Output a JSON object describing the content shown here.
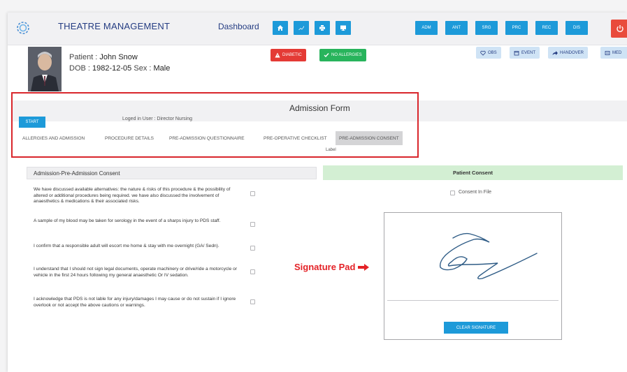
{
  "header": {
    "title": "THEATRE MANAGEMENT",
    "dashboard_label": "Dashboard",
    "icon_buttons": [
      "home-icon",
      "chart-icon",
      "print-icon",
      "monitor-icon"
    ],
    "module_buttons": [
      "ADM",
      "ANT",
      "SRG",
      "PRC",
      "REC",
      "DIS"
    ],
    "accent_color": "#1d9ad9",
    "power_color": "#e94b3c"
  },
  "patient": {
    "name_label": "Patient :",
    "name": "John Snow",
    "dob_label": "DOB :",
    "dob": "1982-12-05",
    "sex_label": "Sex :",
    "sex": "Male"
  },
  "badges": {
    "diabetic": "DIABETIC",
    "no_allergies": "NO ALLERGIES"
  },
  "actions": {
    "obs": "OBS",
    "event": "EVENT",
    "handover": "HANDOVER",
    "med": "MED"
  },
  "form": {
    "title": "Admission Form",
    "start_label": "START",
    "logged_in": "Loged in User : Director Nursing",
    "tabs": [
      "ALLERGIES AND ADMISSION",
      "PROCEDURE DETAILS",
      "PRE-ADMISSION QUESTIONNAIRE",
      "PRE-OPERATIVE CHECKLIST",
      "PRE-ADMISSION CONSENT"
    ],
    "active_tab": "PRE-ADMISSION CONSENT",
    "tab_caption": "Label"
  },
  "consent_section": {
    "heading": "Admission-Pre-Admission Consent",
    "items": [
      "We have discussed available alternatives: the nature & risks of this procedure & the possibility of altered or additional procedures being required. we have also discussed the involvement of anaesthetics & medications & their associated risks.",
      "A sample of my blood may be taken for serology in the event of a sharps injury to PDS staff.",
      "I confirm that a responsible adult will escort me home & stay with me overnight (GA/ Sedn).",
      "I understand that I should not sign legal documents, operate machinery or drive/ride a motorcycle or vehicle in the first 24 hours following my general anaesthetic Or IV sedation.",
      "I acknowledge that PDS is not lable for any injury/damages I may cause or do not sustain if I ignore overlook or not accept the above cautions or warnings."
    ]
  },
  "patient_consent": {
    "heading": "Patient Consent",
    "consent_in_file": "Consent In File",
    "clear_signature": "CLEAR SIGNATURE"
  },
  "annotation": {
    "signature_pad_label": "Signature Pad",
    "color": "#e42227"
  }
}
